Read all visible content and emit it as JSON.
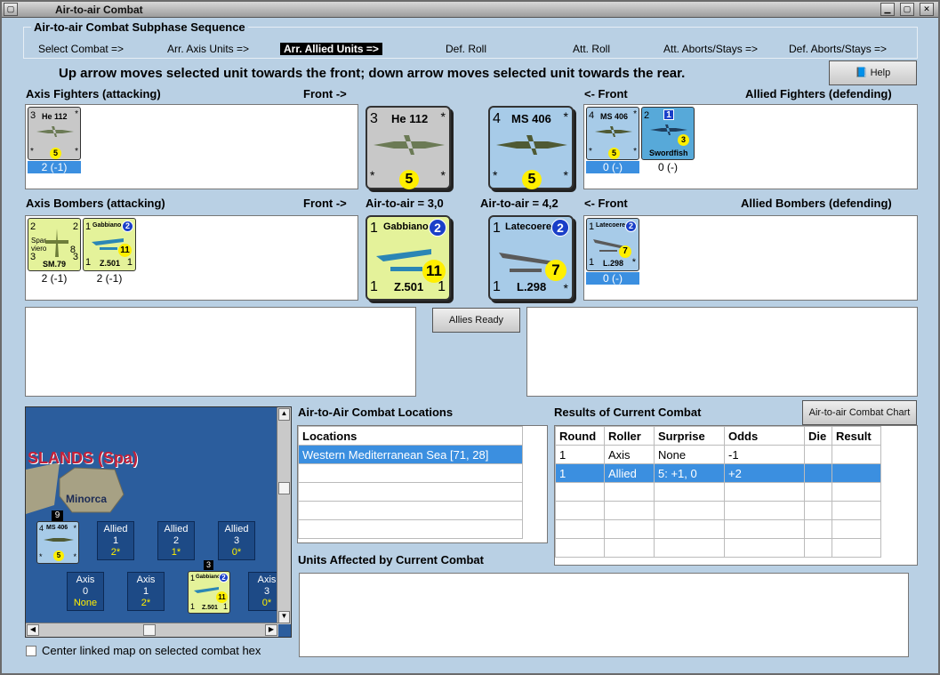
{
  "window": {
    "title": "Air-to-air Combat"
  },
  "sequence": {
    "title": "Air-to-air Combat Subphase Sequence",
    "steps": [
      "Select Combat =>",
      "Arr. Axis Units =>",
      "Arr. Allied Units =>",
      "Def. Roll",
      "Att. Roll",
      "Att. Aborts/Stays =>",
      "Def. Aborts/Stays =>"
    ],
    "active_index": 2
  },
  "instruction": "Up arrow moves selected unit towards the front; down arrow moves selected unit towards the rear.",
  "help_button": "Help",
  "axis_fighters": {
    "label": "Axis Fighters (attacking)",
    "front": "Front ->",
    "units": [
      {
        "name": "He 112",
        "tl": "3",
        "tr": "*",
        "bl": "*",
        "br": "*",
        "val": "5",
        "caption": "2 (-1)",
        "selected": true
      }
    ]
  },
  "allied_fighters": {
    "label": "Allied Fighters (defending)",
    "front": "<- Front",
    "units": [
      {
        "name": "MS 406",
        "tl": "4",
        "tr": "*",
        "bl": "*",
        "br": "*",
        "val": "5",
        "caption": "0 (-)",
        "selected": true
      },
      {
        "name": "Swordfish",
        "tl": "2",
        "badge": "1",
        "val": "3",
        "caption": "0 (-)",
        "selected": false
      }
    ]
  },
  "axis_bombers": {
    "label": "Axis Bombers (attacking)",
    "front": "Front ->",
    "units": [
      {
        "name": "SM.79",
        "sub": "Spar-viero",
        "tl": "2",
        "tr": "2",
        "ml": "3",
        "bl": "3",
        "br": "3",
        "val": "8",
        "caption": "2 (-1)"
      },
      {
        "name": "Z.501",
        "top": "Gabbiano",
        "tl": "1",
        "badge": "2",
        "bl": "1",
        "br": "1",
        "val": "11",
        "caption": "2 (-1)"
      }
    ]
  },
  "allied_bombers": {
    "label": "Allied Bombers (defending)",
    "front": "<- Front",
    "units": [
      {
        "name": "L.298",
        "top": "Latecoere",
        "tl": "1",
        "badge": "2",
        "bl": "1",
        "br": "*",
        "val": "7",
        "caption": "0 (-)",
        "selected": true
      }
    ]
  },
  "center": {
    "axis_fighter": {
      "name": "He 112",
      "tl": "3",
      "tr": "*",
      "bl": "*",
      "br": "*",
      "val": "5"
    },
    "allied_fighter": {
      "name": "MS 406",
      "tl": "4",
      "tr": "*",
      "bl": "*",
      "br": "*",
      "val": "5"
    },
    "axis_air_to_air": "Air-to-air = 3,0",
    "allied_air_to_air": "Air-to-air = 4,2",
    "axis_bomber": {
      "top": "Gabbiano",
      "name": "Z.501",
      "tl": "1",
      "badge": "2",
      "bl": "1",
      "br": "1",
      "val": "11"
    },
    "allied_bomber": {
      "top": "Latecoere",
      "name": "L.298",
      "tl": "1",
      "badge": "2",
      "bl": "1",
      "br": "*",
      "val": "7"
    }
  },
  "allies_ready_button": "Allies Ready",
  "map": {
    "region": "SLANDS (Spa)",
    "island": "Minorca",
    "stack_count": "9",
    "stack_count2": "3",
    "allied": [
      {
        "side": "Allied",
        "round": "1",
        "val": "2*"
      },
      {
        "side": "Allied",
        "round": "2",
        "val": "1*"
      },
      {
        "side": "Allied",
        "round": "3",
        "val": "0*"
      }
    ],
    "axis": [
      {
        "side": "Axis",
        "round": "0",
        "val": "None"
      },
      {
        "side": "Axis",
        "round": "1",
        "val": "2*"
      },
      {
        "side": "Axis",
        "round": "3",
        "val": "0*"
      }
    ],
    "unit1": {
      "name": "MS 406",
      "tl": "4",
      "tr": "*",
      "bl": "*",
      "br": "*",
      "val": "5"
    },
    "unit2": {
      "top": "Gabbiano",
      "name": "Z.501",
      "tl": "1",
      "badge": "2",
      "bl": "1",
      "br": "1",
      "val": "11"
    }
  },
  "center_checkbox": "Center linked map on selected combat hex",
  "locations": {
    "label": "Air-to-Air Combat Locations",
    "header": "Locations",
    "rows": [
      "Western Mediterranean Sea [71, 28]"
    ]
  },
  "results": {
    "label": "Results of Current Combat",
    "chart_button": "Air-to-air Combat Chart",
    "headers": [
      "Round",
      "Roller",
      "Surprise",
      "Odds",
      "Die",
      "Result"
    ],
    "rows": [
      [
        "1",
        "Axis",
        "None",
        "-1",
        "",
        ""
      ],
      [
        "1",
        "Allied",
        "5: +1, 0",
        "+2",
        "",
        ""
      ]
    ],
    "selected_row": 1
  },
  "units_affected": {
    "label": "Units Affected by Current Combat"
  }
}
